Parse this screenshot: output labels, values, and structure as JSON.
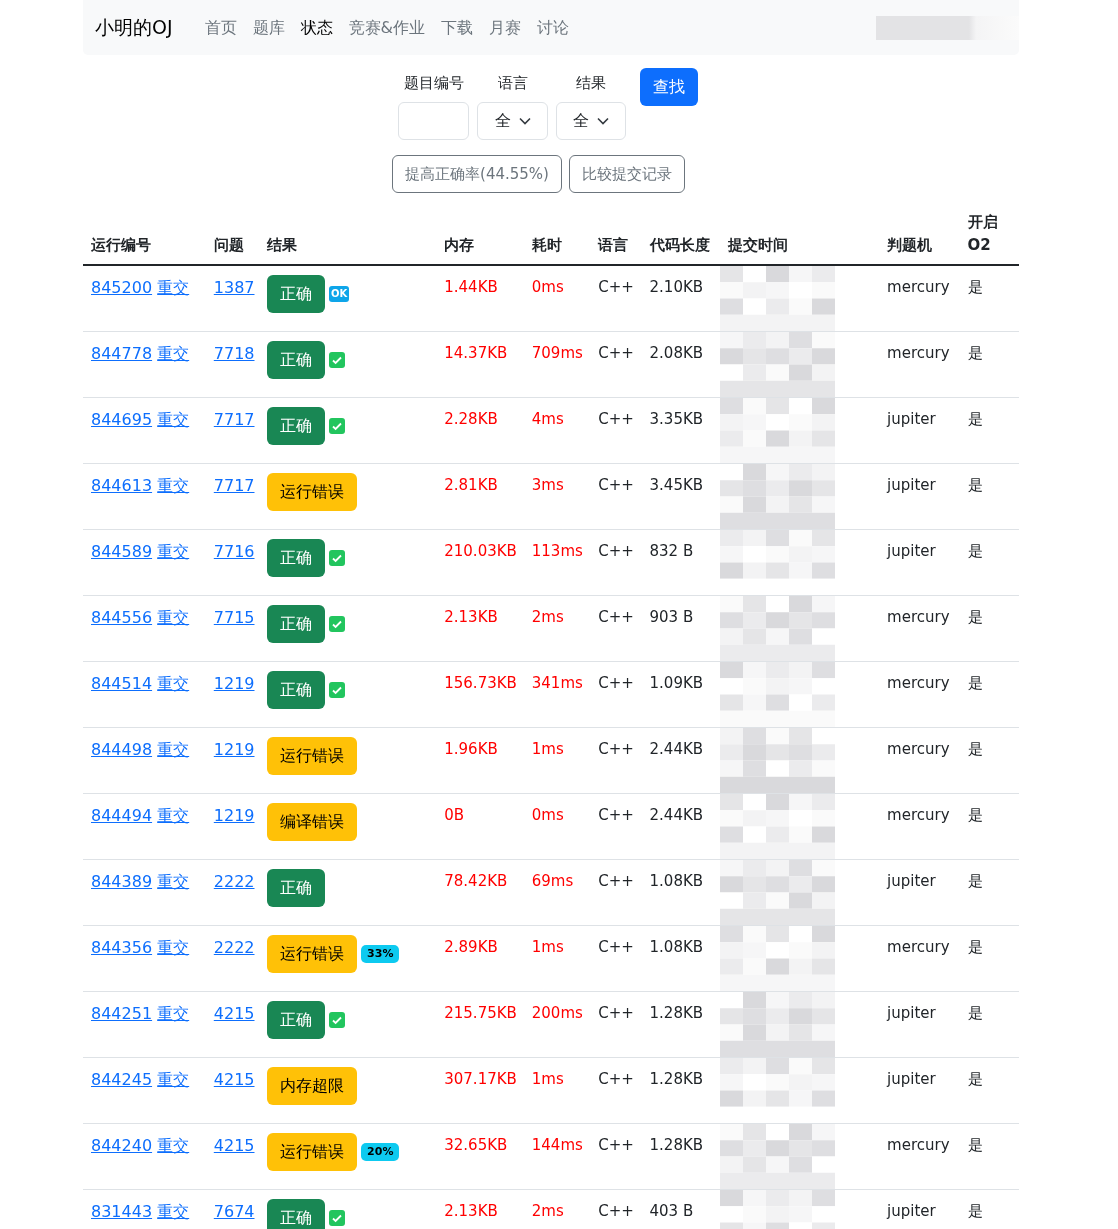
{
  "navbar": {
    "brand": "小明的OJ",
    "items": [
      {
        "label": "首页",
        "selected": false
      },
      {
        "label": "题库",
        "selected": false
      },
      {
        "label": "状态",
        "selected": true
      },
      {
        "label": "竞赛&作业",
        "selected": false
      },
      {
        "label": "下载",
        "selected": false
      },
      {
        "label": "月赛",
        "selected": false
      },
      {
        "label": "讨论",
        "selected": false
      }
    ]
  },
  "filters": {
    "problem_label": "题目编号",
    "language_label": "语言",
    "result_label": "结果",
    "language_value": "全",
    "result_value": "全",
    "search_button": "查找",
    "accuracy_button": "提高正确率(44.55%)",
    "compare_button": "比较提交记录"
  },
  "table": {
    "columns": [
      "运行编号",
      "问题",
      "结果",
      "内存",
      "耗时",
      "语言",
      "代码长度",
      "提交时间",
      "判题机",
      "开启O2"
    ],
    "rows": [
      {
        "run_id": "845200",
        "resubmit": "重交",
        "problem": "1387",
        "result": "正确",
        "kind": "success",
        "ok_tag": "OK",
        "memory": "1.44KB",
        "time": "0ms",
        "language": "C++",
        "code_length": "2.10KB",
        "judge": "mercury",
        "o2": "是"
      },
      {
        "run_id": "844778",
        "resubmit": "重交",
        "problem": "7718",
        "result": "正确",
        "kind": "success",
        "badge": {
          "kind": "check"
        },
        "memory": "14.37KB",
        "time": "709ms",
        "language": "C++",
        "code_length": "2.08KB",
        "judge": "mercury",
        "o2": "是"
      },
      {
        "run_id": "844695",
        "resubmit": "重交",
        "problem": "7717",
        "result": "正确",
        "kind": "success",
        "badge": {
          "kind": "check"
        },
        "memory": "2.28KB",
        "time": "4ms",
        "language": "C++",
        "code_length": "3.35KB",
        "judge": "jupiter",
        "o2": "是"
      },
      {
        "run_id": "844613",
        "resubmit": "重交",
        "problem": "7717",
        "result": "运行错误",
        "kind": "warning",
        "memory": "2.81KB",
        "time": "3ms",
        "language": "C++",
        "code_length": "3.45KB",
        "judge": "jupiter",
        "o2": "是"
      },
      {
        "run_id": "844589",
        "resubmit": "重交",
        "problem": "7716",
        "result": "正确",
        "kind": "success",
        "badge": {
          "kind": "check"
        },
        "memory": "210.03KB",
        "time": "113ms",
        "language": "C++",
        "code_length": "832 B",
        "judge": "jupiter",
        "o2": "是"
      },
      {
        "run_id": "844556",
        "resubmit": "重交",
        "problem": "7715",
        "result": "正确",
        "kind": "success",
        "badge": {
          "kind": "check"
        },
        "memory": "2.13KB",
        "time": "2ms",
        "language": "C++",
        "code_length": "903 B",
        "judge": "mercury",
        "o2": "是"
      },
      {
        "run_id": "844514",
        "resubmit": "重交",
        "problem": "1219",
        "result": "正确",
        "kind": "success",
        "badge": {
          "kind": "check"
        },
        "memory": "156.73KB",
        "time": "341ms",
        "language": "C++",
        "code_length": "1.09KB",
        "judge": "mercury",
        "o2": "是"
      },
      {
        "run_id": "844498",
        "resubmit": "重交",
        "problem": "1219",
        "result": "运行错误",
        "kind": "warning",
        "memory": "1.96KB",
        "time": "1ms",
        "language": "C++",
        "code_length": "2.44KB",
        "judge": "mercury",
        "o2": "是"
      },
      {
        "run_id": "844494",
        "resubmit": "重交",
        "problem": "1219",
        "result": "编译错误",
        "kind": "warning",
        "memory": "0B",
        "time": "0ms",
        "language": "C++",
        "code_length": "2.44KB",
        "judge": "mercury",
        "o2": "是"
      },
      {
        "run_id": "844389",
        "resubmit": "重交",
        "problem": "2222",
        "result": "正确",
        "kind": "success",
        "memory": "78.42KB",
        "time": "69ms",
        "language": "C++",
        "code_length": "1.08KB",
        "judge": "jupiter",
        "o2": "是"
      },
      {
        "run_id": "844356",
        "resubmit": "重交",
        "problem": "2222",
        "result": "运行错误",
        "kind": "warning",
        "badge": {
          "kind": "percent",
          "text": "33%"
        },
        "memory": "2.89KB",
        "time": "1ms",
        "language": "C++",
        "code_length": "1.08KB",
        "judge": "mercury",
        "o2": "是"
      },
      {
        "run_id": "844251",
        "resubmit": "重交",
        "problem": "4215",
        "result": "正确",
        "kind": "success",
        "badge": {
          "kind": "check"
        },
        "memory": "215.75KB",
        "time": "200ms",
        "language": "C++",
        "code_length": "1.28KB",
        "judge": "jupiter",
        "o2": "是"
      },
      {
        "run_id": "844245",
        "resubmit": "重交",
        "problem": "4215",
        "result": "内存超限",
        "kind": "warning",
        "memory": "307.17KB",
        "time": "1ms",
        "language": "C++",
        "code_length": "1.28KB",
        "judge": "jupiter",
        "o2": "是"
      },
      {
        "run_id": "844240",
        "resubmit": "重交",
        "problem": "4215",
        "result": "运行错误",
        "kind": "warning",
        "badge": {
          "kind": "percent",
          "text": "20%"
        },
        "memory": "32.65KB",
        "time": "144ms",
        "language": "C++",
        "code_length": "1.28KB",
        "judge": "mercury",
        "o2": "是"
      },
      {
        "run_id": "831443",
        "resubmit": "重交",
        "problem": "7674",
        "result": "正确",
        "kind": "success",
        "badge": {
          "kind": "check"
        },
        "memory": "2.13KB",
        "time": "2ms",
        "language": "C++",
        "code_length": "403 B",
        "judge": "jupiter",
        "o2": "是"
      }
    ]
  }
}
